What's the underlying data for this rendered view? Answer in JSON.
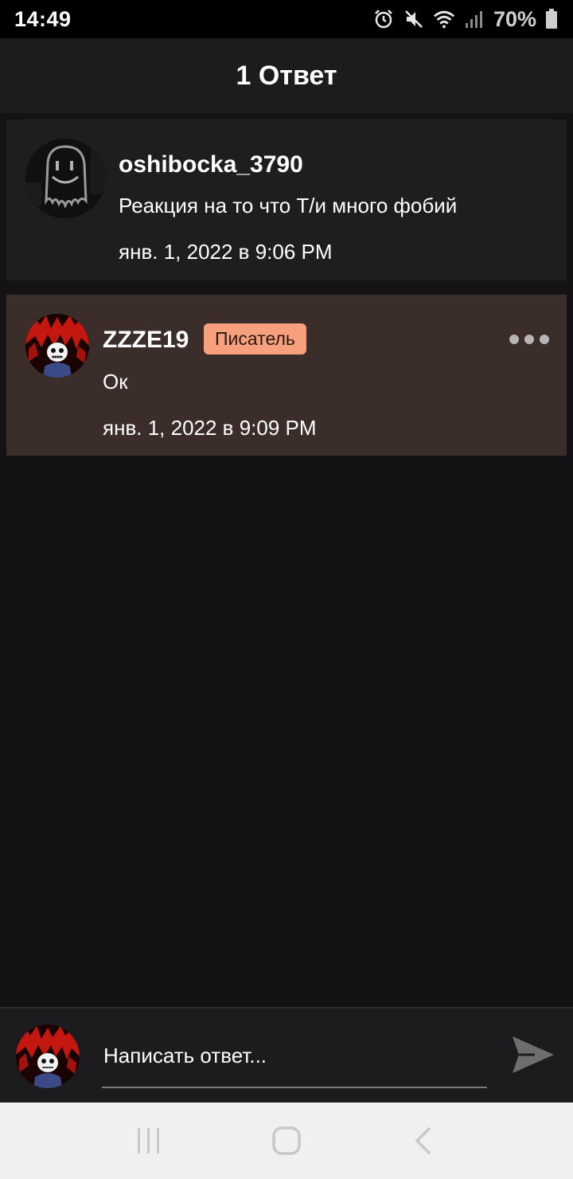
{
  "status_bar": {
    "time": "14:49",
    "battery_percent": "70%",
    "icons": [
      "alarm-icon",
      "mute-icon",
      "wifi-icon",
      "signal-icon",
      "battery-icon"
    ]
  },
  "header": {
    "title": "1 Ответ"
  },
  "parent_comment": {
    "avatar": "ghost-avatar",
    "username": "oshibocka_3790",
    "text": "Реакция на то что Т/и много фобий",
    "timestamp": "янв. 1, 2022 в 9:06 PM"
  },
  "reply_comment": {
    "avatar": "sans-avatar",
    "username": "ZZZE19",
    "badge": "Писатель",
    "text": "Ок",
    "timestamp": "янв. 1, 2022 в 9:09 PM",
    "more_icon": "more-icon"
  },
  "reply_bar": {
    "placeholder": "Написать ответ...",
    "send_icon": "send-icon"
  },
  "nav_bar": {
    "icons": [
      "recent-apps-icon",
      "home-icon",
      "back-icon"
    ]
  },
  "colors": {
    "background": "#141214",
    "card": "#1e1d20",
    "reply_card": "#3b2d2a",
    "badge": "#f6a07e",
    "status_bar": "#000000"
  }
}
